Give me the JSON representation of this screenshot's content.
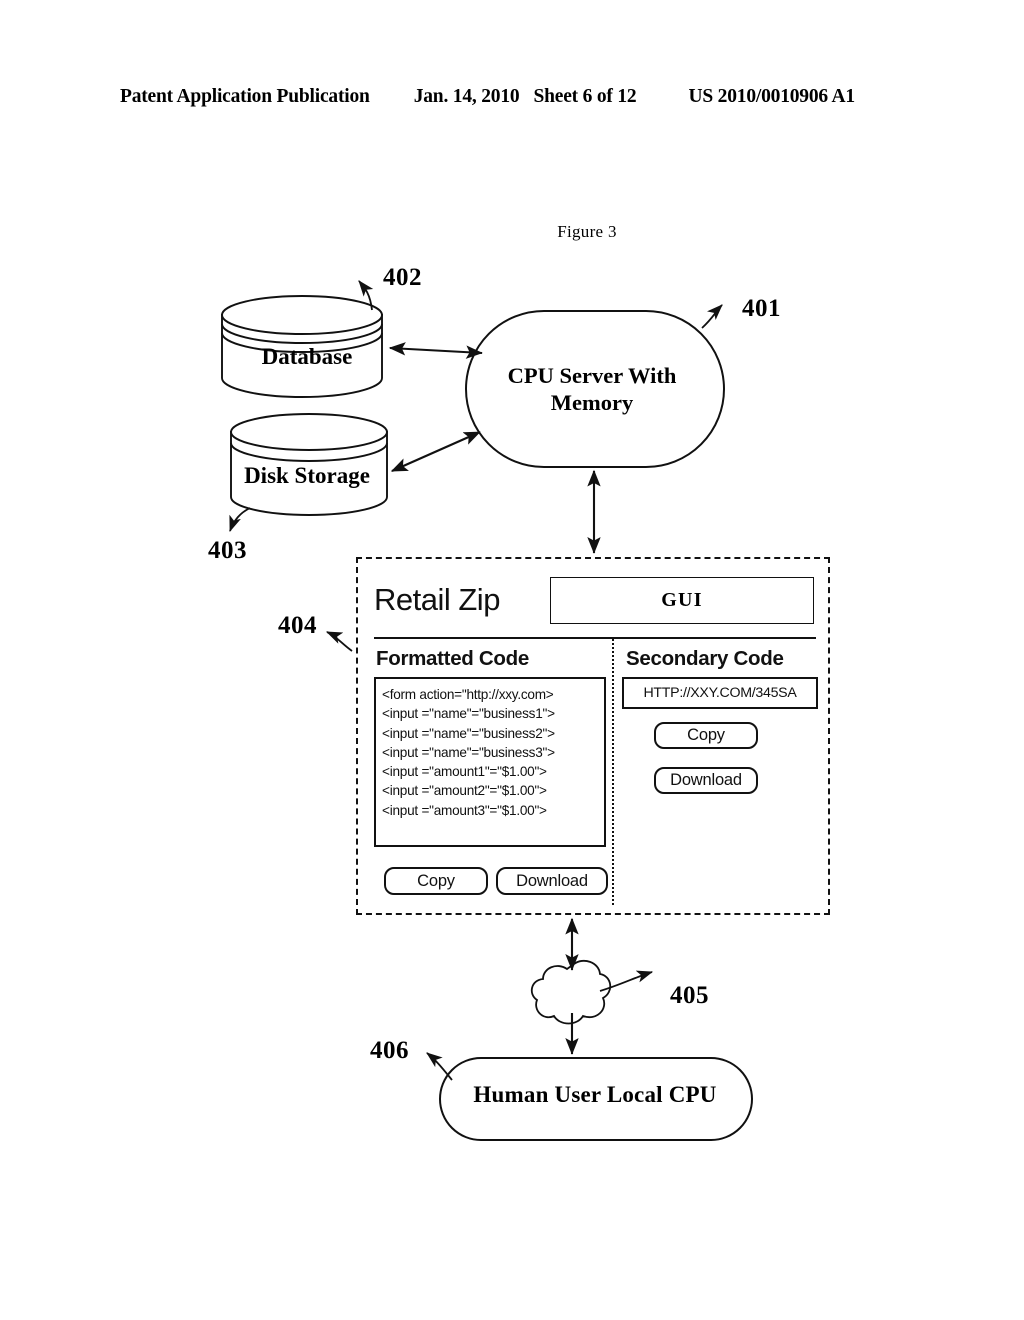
{
  "header": {
    "publication": "Patent Application Publication",
    "date": "Jan. 14, 2010",
    "sheet": "Sheet 6 of 12",
    "number": "US 2010/0010906 A1"
  },
  "figure": {
    "title": "Figure 3"
  },
  "refs": {
    "r401": "401",
    "r402": "402",
    "r403": "403",
    "r404": "404",
    "r405": "405",
    "r406": "406"
  },
  "nodes": {
    "database": "Database",
    "disk_storage": "Disk Storage",
    "cpu_server": "CPU Server With\nMemory",
    "cloud": "network-cloud",
    "human_user": "Human User Local CPU"
  },
  "panel": {
    "app_title": "Retail Zip",
    "gui_label": "GUI",
    "formatted_heading": "Formatted Code",
    "secondary_heading": "Secondary Code",
    "code_lines": [
      "<form action=\"http://xxy.com>",
      "<input =\"name\"=\"business1\">",
      "<input =\"name\"=\"business2\">",
      "<input =\"name\"=\"business3\">",
      "<input =\"amount1\"=\"$1.00\">",
      "<input =\"amount2\"=\"$1.00\">",
      "<input =\"amount3\"=\"$1.00\">"
    ],
    "secondary_url": "HTTP://XXY.COM/345SA",
    "buttons": {
      "formatted_copy": "Copy",
      "formatted_download": "Download",
      "secondary_copy": "Copy",
      "secondary_download": "Download"
    }
  },
  "colors": {
    "ink": "#111111",
    "background": "#ffffff"
  }
}
